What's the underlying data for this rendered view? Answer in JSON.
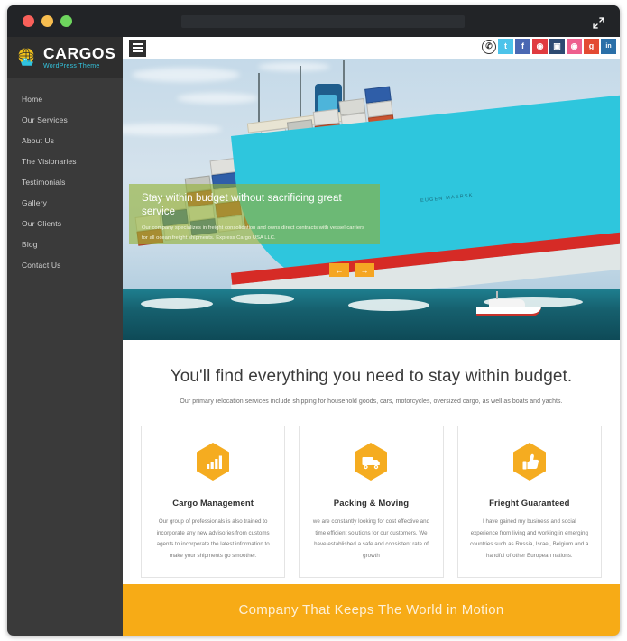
{
  "window": {
    "traffic_lights": [
      "close",
      "minimize",
      "maximize"
    ],
    "url_value": "",
    "url_placeholder": "",
    "expand_icon": "expand-fullscreen-icon"
  },
  "sidebar": {
    "logo": {
      "title": "CARGOS",
      "subtitle": "WordPress Theme",
      "mark": "globe-ship-icon"
    },
    "items": [
      {
        "label": "Home"
      },
      {
        "label": "Our Services"
      },
      {
        "label": "About Us"
      },
      {
        "label": "The Visionaries"
      },
      {
        "label": "Testimonials"
      },
      {
        "label": "Gallery"
      },
      {
        "label": "Our Clients"
      },
      {
        "label": "Blog"
      },
      {
        "label": "Contact Us"
      }
    ]
  },
  "topbar": {
    "menu_icon": "hamburger-menu-icon",
    "social": [
      {
        "name": "phone-icon",
        "glyph": "✆",
        "color": "#ffffff"
      },
      {
        "name": "twitter-icon",
        "glyph": "t",
        "color": "#4cc3ea"
      },
      {
        "name": "facebook-icon",
        "glyph": "f",
        "color": "#4a68b3"
      },
      {
        "name": "pinterest-icon",
        "glyph": "◉",
        "color": "#e03a3f"
      },
      {
        "name": "instagram-icon",
        "glyph": "▣",
        "color": "#2d4a72"
      },
      {
        "name": "dribbble-icon",
        "glyph": "◉",
        "color": "#ee5f8e"
      },
      {
        "name": "google-plus-icon",
        "glyph": "g",
        "color": "#e34a33"
      },
      {
        "name": "linkedin-icon",
        "glyph": "in",
        "color": "#2a6fa8"
      }
    ]
  },
  "hero": {
    "ship_name": "EUGEN MAERSK",
    "caption": {
      "heading": "Stay within budget without sacrificing great service",
      "body": "Our company specializes in freight consolidation and owns direct contracts with vessel carriers for all ocean freight shipments. Express Cargo USA LLC."
    },
    "slider": {
      "prev_label": "←",
      "next_label": "→"
    },
    "accent_color": "#f5a623",
    "panel_color": "#93b235"
  },
  "services": {
    "title": "You'll find everything you need to stay within budget.",
    "subtitle": "Our primary relocation services include shipping for household goods, cars, motorcycles, oversized cargo, as well as boats and yachts.",
    "cards": [
      {
        "icon": "bar-chart-icon",
        "title": "Cargo Management",
        "body": "Our group of professionals is also trained to incorporate any new advisories from customs agents to incorporate the latest information to make your shipments go smoother."
      },
      {
        "icon": "truck-icon",
        "title": "Packing & Moving",
        "body": "we are constantly looking for cost effective and time efficient solutions for our customers. We have established a safe and consistent rate of growth"
      },
      {
        "icon": "thumbs-up-icon",
        "title": "Frieght Guaranteed",
        "body": "I have gained my business and social experience from living and working in emerging countries such as Russia, Israel, Belgium and a handful of other European nations."
      }
    ]
  },
  "footer": {
    "tagline": "Company That Keeps The World in Motion",
    "background": "#f7ab16"
  }
}
